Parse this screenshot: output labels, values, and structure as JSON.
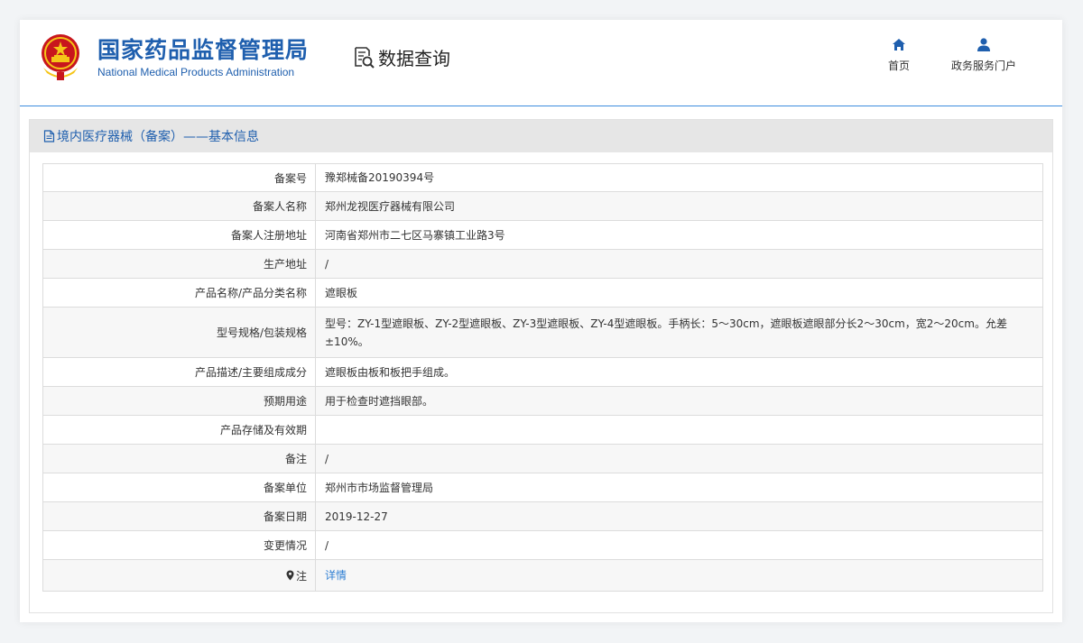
{
  "header": {
    "org_name_cn": "国家药品监督管理局",
    "org_name_en": "National Medical Products Administration",
    "page_title": "数据查询",
    "nav": [
      {
        "label": "首页",
        "icon": "home-icon"
      },
      {
        "label": "政务服务门户",
        "icon": "user-icon"
      }
    ]
  },
  "colors": {
    "brand": "#1f5fae",
    "link": "#2f7fd3",
    "divider": "#3c8dde"
  },
  "panel": {
    "title": "境内医疗器械（备案）——基本信息"
  },
  "record": {
    "rows": [
      {
        "label": "备案号",
        "value": "豫郑械备20190394号"
      },
      {
        "label": "备案人名称",
        "value": "郑州龙视医疗器械有限公司"
      },
      {
        "label": "备案人注册地址",
        "value": "河南省郑州市二七区马寨镇工业路3号"
      },
      {
        "label": "生产地址",
        "value": "/"
      },
      {
        "label": "产品名称/产品分类名称",
        "value": "遮眼板"
      },
      {
        "label": "型号规格/包装规格",
        "value": "型号：ZY-1型遮眼板、ZY-2型遮眼板、ZY-3型遮眼板、ZY-4型遮眼板。手柄长：5～30cm，遮眼板遮眼部分长2～30cm，宽2～20cm。允差±10%。"
      },
      {
        "label": "产品描述/主要组成成分",
        "value": "遮眼板由板和板把手组成。"
      },
      {
        "label": "预期用途",
        "value": "用于检查时遮挡眼部。"
      },
      {
        "label": "产品存储及有效期",
        "value": ""
      },
      {
        "label": "备注",
        "value": "/"
      },
      {
        "label": "备案单位",
        "value": "郑州市市场监督管理局"
      },
      {
        "label": "备案日期",
        "value": "2019-12-27"
      },
      {
        "label": "变更情况",
        "value": "/"
      }
    ],
    "note": {
      "label": "注",
      "link_text": "详情"
    }
  }
}
